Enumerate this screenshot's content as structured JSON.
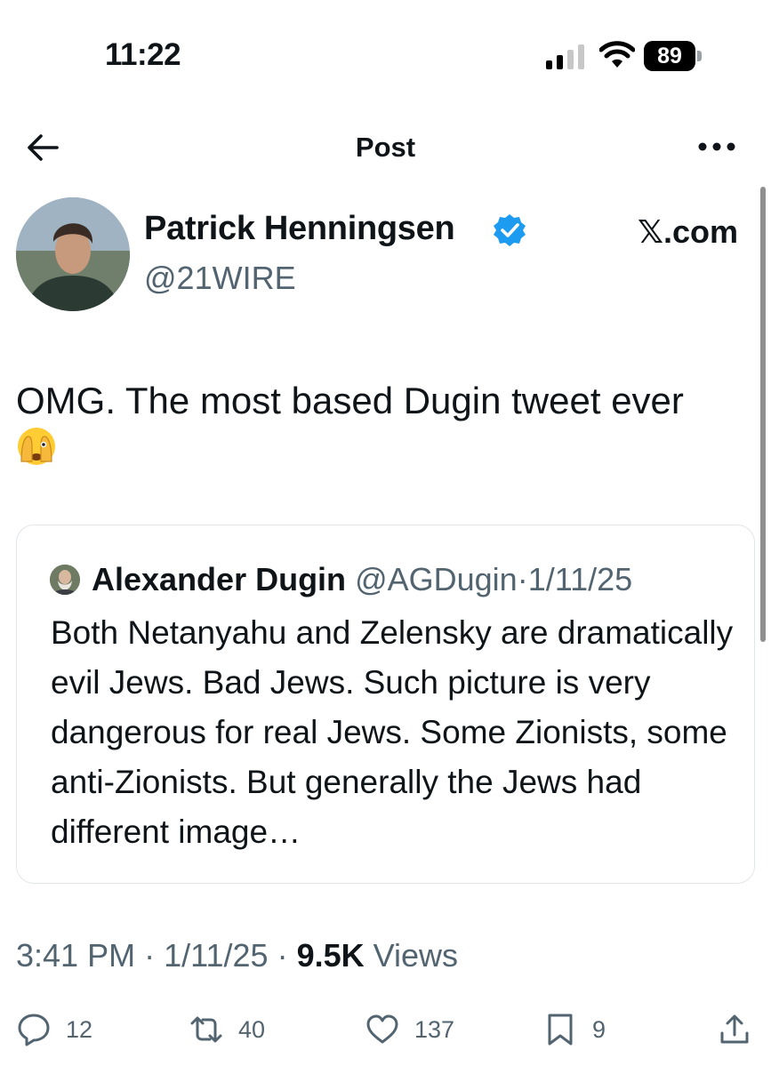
{
  "status_bar": {
    "time": "11:22",
    "battery": "89"
  },
  "nav": {
    "title": "Post"
  },
  "post": {
    "author_name": "Patrick Henningsen",
    "handle": "@21WIRE",
    "source": "𝕏.com",
    "text": "OMG. The most based Dugin tweet ever",
    "emoji": "face-with-peeking-eye",
    "quote": {
      "author_name": "Alexander Dugin",
      "handle": "@AGDugin",
      "separator": "·",
      "date": "1/11/25",
      "text": "Both Netanyahu and Zelensky  are dramatically evil Jews. Bad Jews. Such picture is very dangerous for real Jews. Some Zionists, some anti-Zionists. But generally the Jews had different image…"
    },
    "timestamp": {
      "time": "3:41 PM",
      "sep1": "·",
      "date": "1/11/25",
      "sep2": "·",
      "views_count": "9.5K",
      "views_label": "Views"
    },
    "actions": {
      "replies": "12",
      "reposts": "40",
      "likes": "137",
      "bookmarks": "9"
    }
  },
  "colors": {
    "verified": "#1d9bf0",
    "muted": "#536471",
    "text": "#0f1419",
    "border": "#e1e6ea"
  },
  "icons": [
    "back-arrow-icon",
    "more-icon",
    "verified-badge-icon",
    "reply-icon",
    "repost-icon",
    "like-icon",
    "bookmark-icon",
    "share-icon"
  ]
}
